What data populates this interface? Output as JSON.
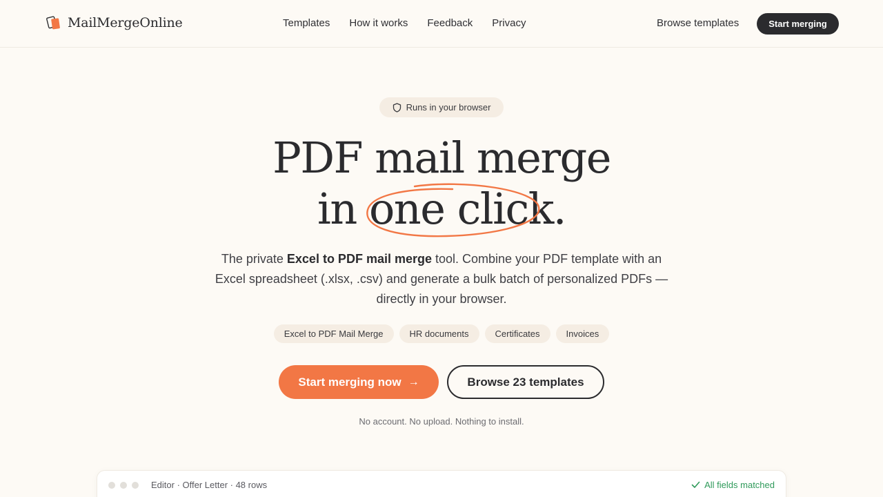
{
  "colors": {
    "accent": "#f27745",
    "dark": "#2b2b2e",
    "background": "#fdfaf5",
    "chip": "#f5ede3",
    "success": "#2f9a5a"
  },
  "nav": {
    "brand": "MailMergeOnline",
    "brand_icon": "stacked-documents-icon",
    "links": [
      "Templates",
      "How it works",
      "Feedback",
      "Privacy"
    ],
    "browse_label": "Browse templates",
    "start_label": "Start merging"
  },
  "hero": {
    "badge_icon": "shield-icon",
    "badge": "Runs in your browser",
    "headline_line1": "PDF mail merge",
    "headline_line2_prefix": "in ",
    "headline_circled": "one click",
    "headline_suffix": ".",
    "subtitle_pre": "The private ",
    "subtitle_bold": "Excel to PDF mail merge",
    "subtitle_post": " tool. Combine your PDF template with an Excel spreadsheet (.xlsx, .csv) and generate a bulk batch of personalized PDFs — directly in your browser.",
    "chips": [
      "Excel to PDF Mail Merge",
      "HR documents",
      "Certificates",
      "Invoices"
    ],
    "cta_primary": "Start merging now",
    "cta_primary_icon": "arrow-right-icon",
    "cta_secondary": "Browse 23 templates",
    "note": "No account. No upload. Nothing to install."
  },
  "editor": {
    "title": "Editor · Offer Letter · 48 rows",
    "status_icon": "check-icon",
    "status": "All fields matched"
  }
}
